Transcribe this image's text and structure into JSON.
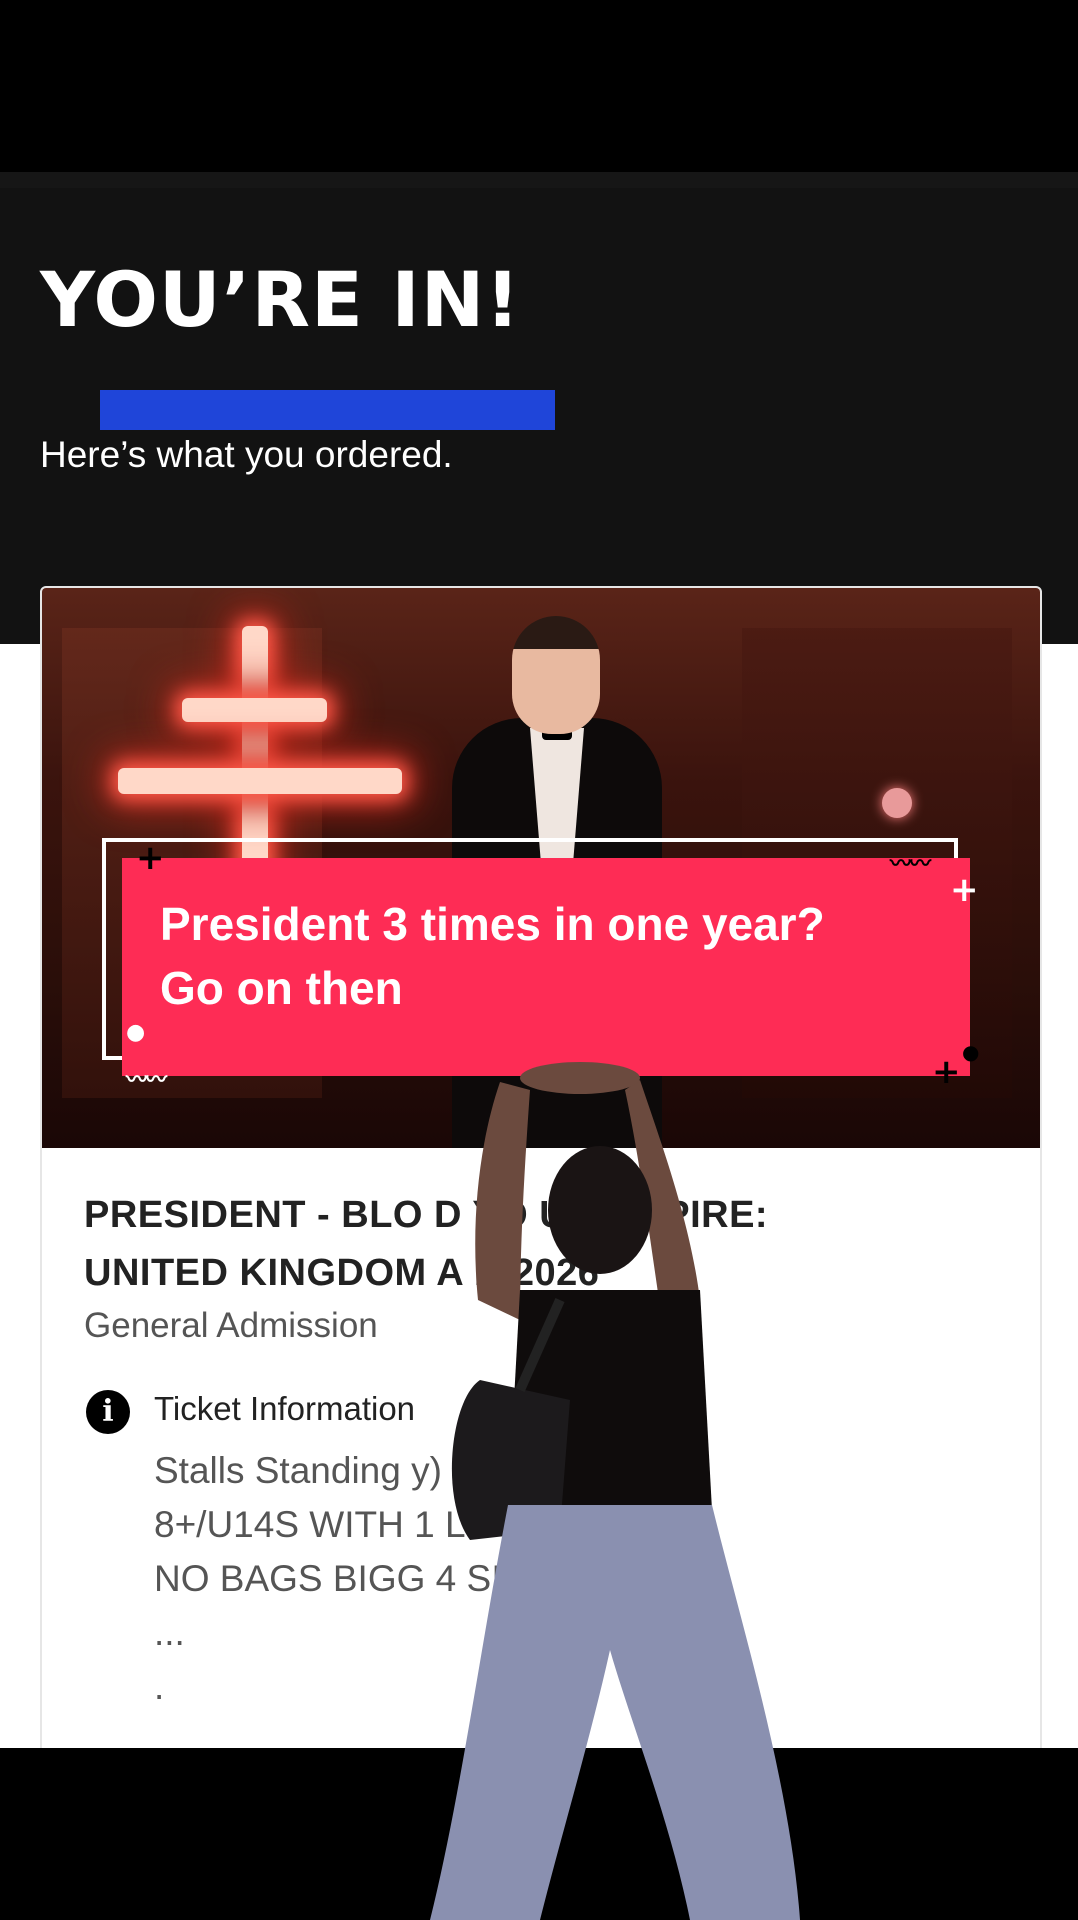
{
  "confirmation": {
    "headline": "YOU’RE IN!",
    "subline": "Here’s what you ordered."
  },
  "caption": {
    "line1": "President 3 times in one year?",
    "line2": "Go on then"
  },
  "event": {
    "title_line1": "PRESIDENT - BLO   D      YO  UR EMPIRE:",
    "title_line2": "UNITED KINGDOM            A   N 2026",
    "ticket_type": "General Admission"
  },
  "ticket_info": {
    "label": "Ticket Information",
    "icon": "info-icon",
    "lines": [
      "Stalls Standing                 y)",
      "8+/U14S WITH 1                LE",
      "NO BAGS BIGG                 4 SIZE",
      "...",
      "."
    ]
  },
  "colors": {
    "accent_blue": "#1f45d9",
    "caption_red": "#fe2c55",
    "dark_bg": "#121212"
  }
}
